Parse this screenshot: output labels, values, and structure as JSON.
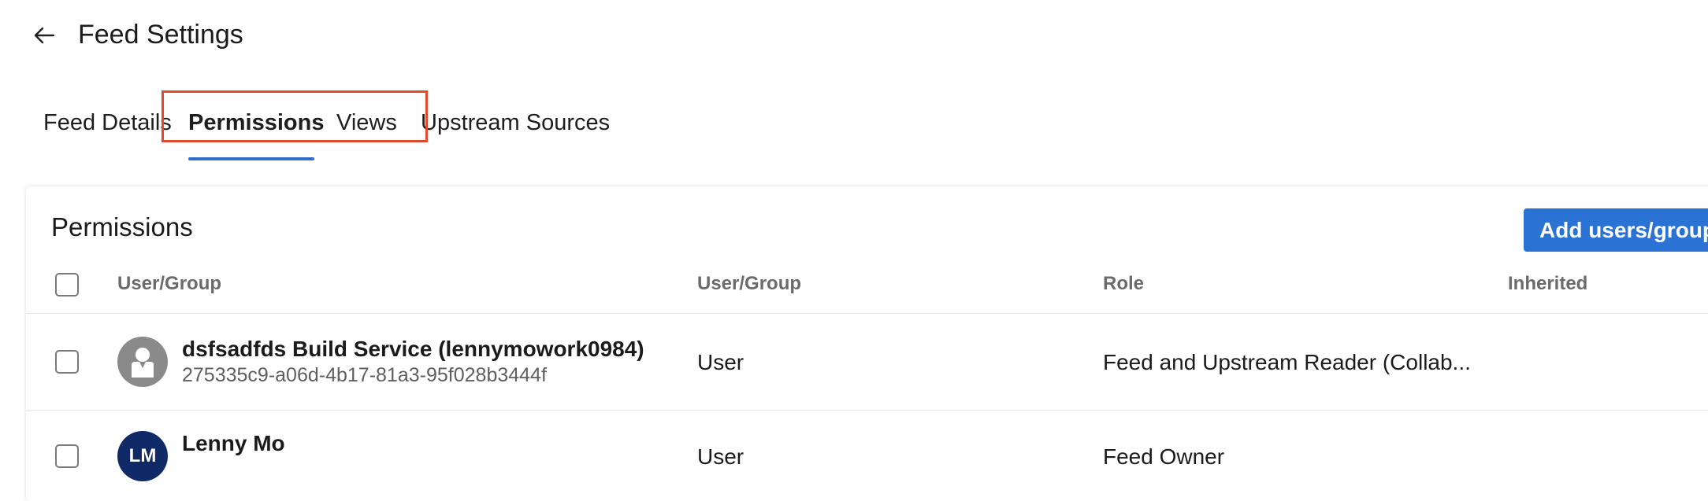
{
  "header": {
    "title": "Feed Settings",
    "back_icon": "arrow-left-icon"
  },
  "tabs": [
    {
      "label": "Feed Details",
      "active": false
    },
    {
      "label": "Permissions",
      "active": true
    },
    {
      "label": "Views",
      "active": false
    },
    {
      "label": "Upstream Sources",
      "active": false
    }
  ],
  "permissions": {
    "title": "Permissions",
    "add_button_label": "Add users/groups",
    "columns": [
      "User/Group",
      "User/Group",
      "Role",
      "Inherited"
    ],
    "rows": [
      {
        "name": "dsfsadfds Build Service (lennymowork0984)",
        "id": "275335c9-a06d-4b17-81a3-95f028b3444f",
        "type": "User",
        "role": "Feed and Upstream Reader (Collab...",
        "avatar": "service-avatar-icon"
      },
      {
        "name": "Lenny Mo",
        "type": "User",
        "role": "Feed Owner",
        "avatar_initials": "LM"
      }
    ]
  },
  "colors": {
    "accent": "#2a72d4",
    "highlight": "#e04a2c",
    "avatar_dark": "#0f2a66",
    "avatar_gray": "#8a8a8a"
  }
}
